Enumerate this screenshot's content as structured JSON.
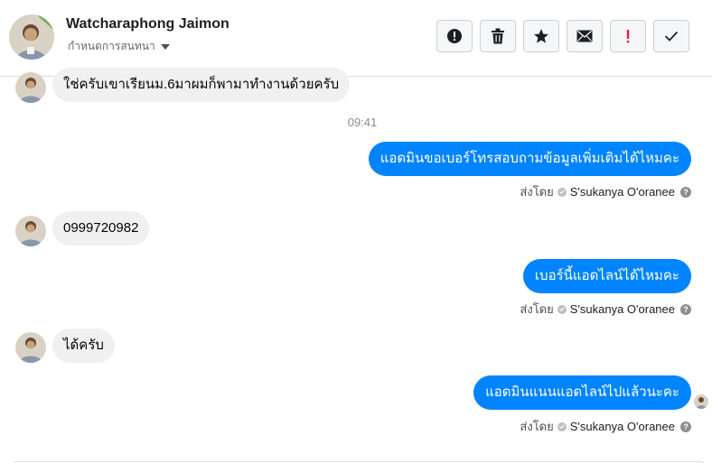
{
  "header": {
    "name": "Watcharaphong Jaimon",
    "assign_label": "กำหนดการสนทนา"
  },
  "toolbar": [
    {
      "icon": "alert-circle-icon"
    },
    {
      "icon": "trash-icon"
    },
    {
      "icon": "star-icon"
    },
    {
      "icon": "mail-icon"
    },
    {
      "icon": "exclamation-icon"
    },
    {
      "icon": "check-icon"
    }
  ],
  "conversation": {
    "timestamp": "09:41",
    "messages": [
      {
        "direction": "in",
        "text": "ใช่ครับเขาเรียนม.6มาผมก็พามาทำงานด้วยครับ"
      },
      {
        "direction": "out",
        "text": "แอดมินขอเบอร์โทรสอบถามข้อมูลเพิ่มเติมได้ไหมคะ"
      },
      {
        "direction": "in",
        "text": "0999720982"
      },
      {
        "direction": "out",
        "text": "เบอร์นี้แอดไลน์ได้ไหมคะ"
      },
      {
        "direction": "in",
        "text": "ได้ครับ"
      },
      {
        "direction": "out",
        "text": "แอดมินแนนแอดไลน์ไปแล้วนะคะ"
      }
    ],
    "sent_by": {
      "label": "ส่งโดย",
      "name": "S'sukanya O'oranee",
      "help": "?"
    }
  },
  "colors": {
    "outgoing_bubble": "#0084ff",
    "incoming_bubble": "#f0f0f0",
    "alert_red": "#e41e3f"
  }
}
